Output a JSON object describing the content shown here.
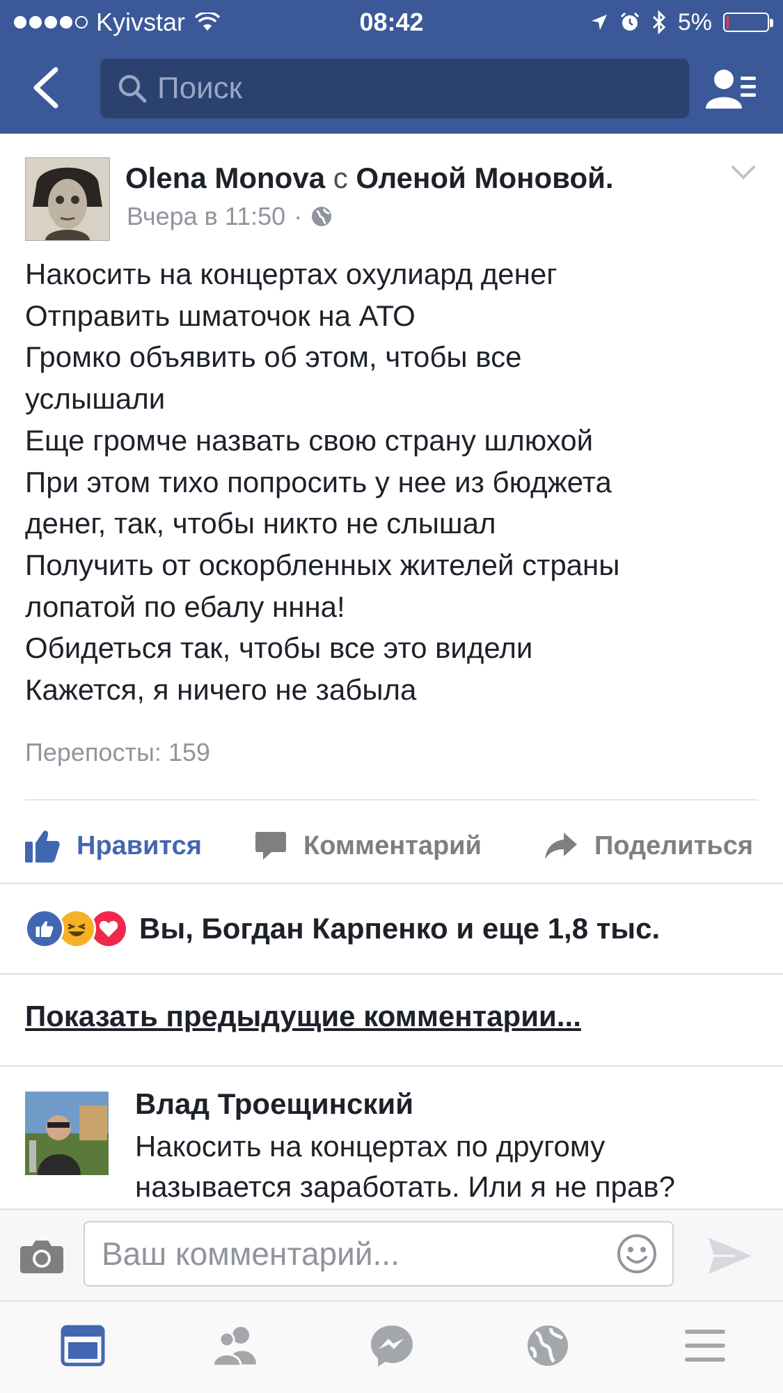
{
  "status_bar": {
    "carrier": "Kyivstar",
    "time": "08:42",
    "battery": "5%",
    "battery_level": 0.05
  },
  "header": {
    "search_placeholder": "Поиск"
  },
  "post": {
    "author": "Olena Monova",
    "with_word": "с",
    "tagged": "Оленой Моновой.",
    "timestamp": "Вчера в 11:50",
    "separator": "·",
    "body_lines": [
      "Накосить на концертах охулиард денег",
      "Отправить шматочок на АТО",
      "Громко объявить об этом, чтобы все",
      "услышали",
      "Еще громче назвать свою страну шлюхой",
      "При этом тихо попросить у нее из бюджета",
      "денег, так, чтобы никто не слышал",
      "Получить от оскорбленных жителей страны",
      "лопатой по ебалу ннна!",
      "Обидеться так, чтобы все это видели",
      "Кажется, я ничего не забыла"
    ],
    "shares": "Перепосты: 159"
  },
  "actions": {
    "like": "Нравится",
    "comment": "Комментарий",
    "share": "Поделиться"
  },
  "reactions": {
    "summary": "Вы, Богдан Карпенко и еще 1,8 тыс."
  },
  "comments": {
    "show_previous": "Показать предыдущие комментарии...",
    "items": [
      {
        "author": "Влад Троещинский",
        "text_lines": [
          "Накосить на концертах по другому",
          "называется заработать. Или я не прав?"
        ]
      }
    ]
  },
  "composer": {
    "placeholder": "Ваш комментарий..."
  },
  "colors": {
    "brand": "#3b5998",
    "like_blue": "#4267b2",
    "love_red": "#f0284a",
    "haha_yellow": "#f7b125"
  }
}
